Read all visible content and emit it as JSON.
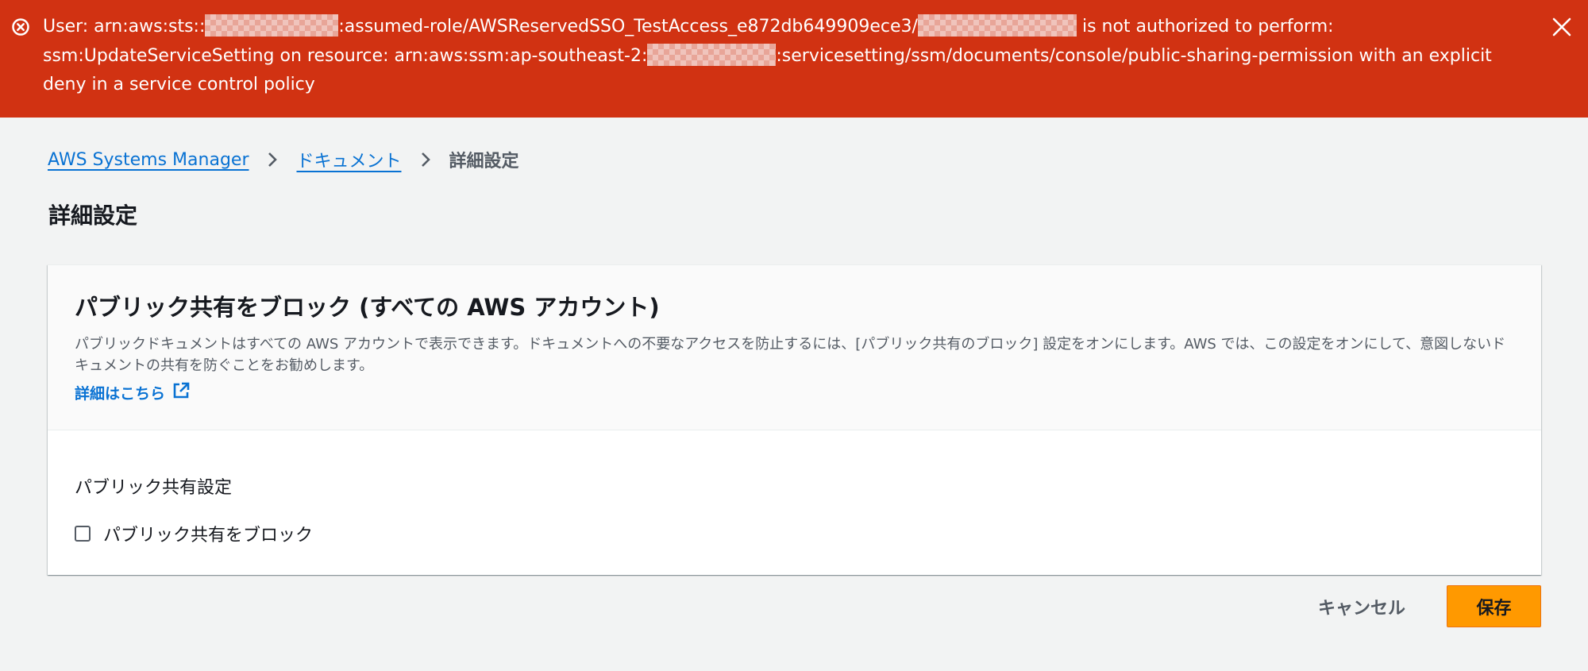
{
  "banner": {
    "type": "error",
    "colors": {
      "background": "#d13212",
      "text": "#ffffff"
    },
    "message_part1": "User: arn:aws:sts::",
    "message_part2": ":assumed-role/AWSReservedSSO_TestAccess_e872db649909ece3/",
    "message_part3": " is not authorized to perform: ssm:UpdateServiceSetting on resource: arn:aws:ssm:ap-southeast-2:",
    "message_part4": ":servicesetting/ssm/documents/console/public-sharing-permission with an explicit deny in a service control policy",
    "icons": {
      "status": "error-circle-icon",
      "dismiss": "close-icon"
    }
  },
  "breadcrumb": {
    "items": [
      {
        "label": "AWS Systems Manager",
        "link": true
      },
      {
        "label": "ドキュメント",
        "link": true
      },
      {
        "label": "詳細設定",
        "link": false
      }
    ]
  },
  "page": {
    "title": "詳細設定"
  },
  "container": {
    "title": "パブリック共有をブロック (すべての AWS アカウント)",
    "description": "パブリックドキュメントはすべての AWS アカウントで表示できます。ドキュメントへの不要なアクセスを防止するには、[パブリック共有のブロック] 設定をオンにします。AWS では、この設定をオンにして、意図しないドキュメントの共有を防ぐことをお勧めします。",
    "info_link": "詳細はこちら",
    "field_label": "パブリック共有設定",
    "checkbox": {
      "label": "パブリック共有をブロック",
      "checked": false
    }
  },
  "actions": {
    "cancel_label": "キャンセル",
    "save_label": "保存",
    "colors": {
      "primary": "#ff9900",
      "link": "#0972d3"
    }
  }
}
